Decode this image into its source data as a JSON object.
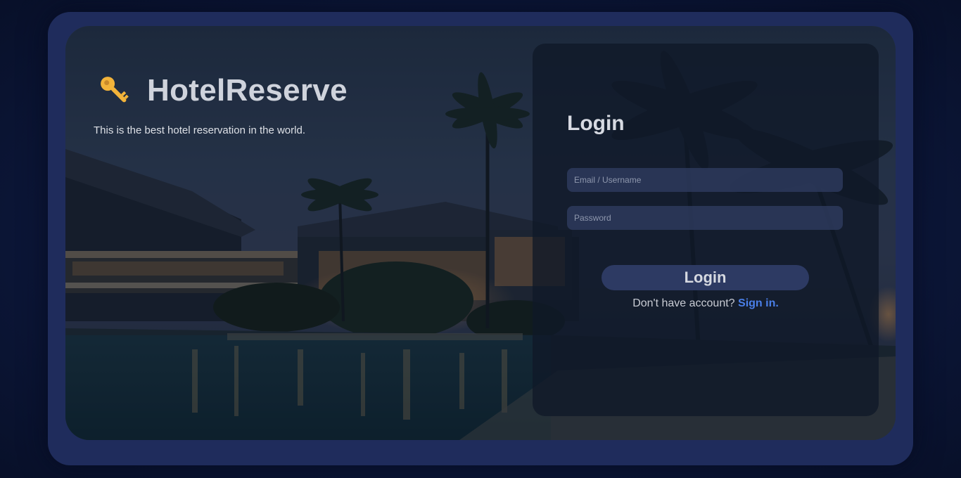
{
  "brand": {
    "title": "HotelReserve",
    "tagline": "This is the best hotel reservation in the world.",
    "icon": "key-icon"
  },
  "login": {
    "title": "Login",
    "email_placeholder": "Email / Username",
    "password_placeholder": "Password",
    "button_label": "Login",
    "signup_prompt": "Don't have account?",
    "signup_link": "Sign in."
  },
  "colors": {
    "page_background": "#0b1433",
    "frame": "#1f2c5c",
    "accent_link": "#4a7fe8",
    "button": "#2d3a63",
    "key_icon": "#f2b33a"
  }
}
